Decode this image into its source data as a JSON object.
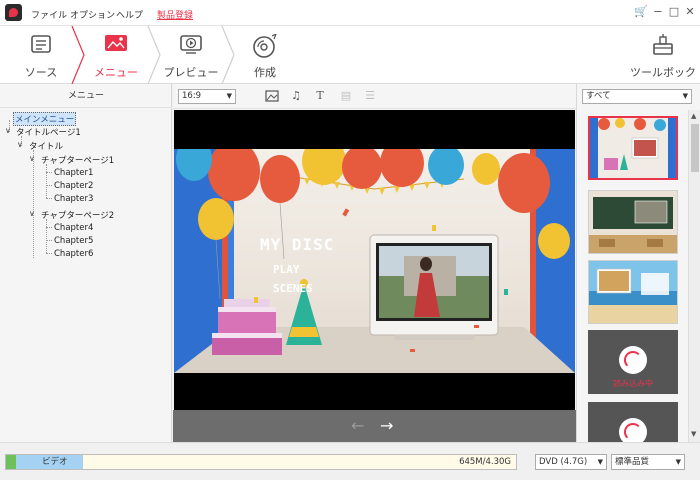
{
  "titlebar": {
    "menus": [
      "ファイル",
      "オプション",
      "ヘルプ"
    ],
    "register": "製品登録"
  },
  "steps": [
    {
      "label": "ソース",
      "icon": "source-icon",
      "active": false
    },
    {
      "label": "メニュー",
      "icon": "menu-icon",
      "active": true
    },
    {
      "label": "プレビュー",
      "icon": "preview-icon",
      "active": false
    },
    {
      "label": "作成",
      "icon": "burn-disc-icon",
      "active": false
    }
  ],
  "toolbox": {
    "label": "ツールボックス",
    "icon": "toolbox-icon"
  },
  "left_panel": {
    "title": "メニュー",
    "tree": {
      "root": "メインメニュー",
      "title_page": "タイトルページ1",
      "title": "タイトル",
      "chapter_page_1": "チャプターページ1",
      "chapters_1": [
        "Chapter1",
        "Chapter2",
        "Chapter3"
      ],
      "chapter_page_2": "チャプターページ2",
      "chapters_2": [
        "Chapter4",
        "Chapter5",
        "Chapter6"
      ]
    }
  },
  "center": {
    "aspect_ratio": "16:9",
    "tools": [
      "image-icon",
      "music-icon",
      "text-icon",
      "copy-icon",
      "document-icon"
    ],
    "preview": {
      "disc_title": "MY DISC",
      "play": "PLAY",
      "scenes": "SCENES"
    }
  },
  "right_panel": {
    "filter": "すべて",
    "loading_text": "読み込み中"
  },
  "bottom": {
    "video_label": "ビデオ",
    "size": "645M/4.30G",
    "disc_type": "DVD (4.7G)",
    "quality": "標準品質",
    "used_fraction": 0.15
  },
  "colors": {
    "accent": "#e8334a",
    "bar_blue": "#a5d2f3",
    "bar_green": "#6ec05b"
  }
}
